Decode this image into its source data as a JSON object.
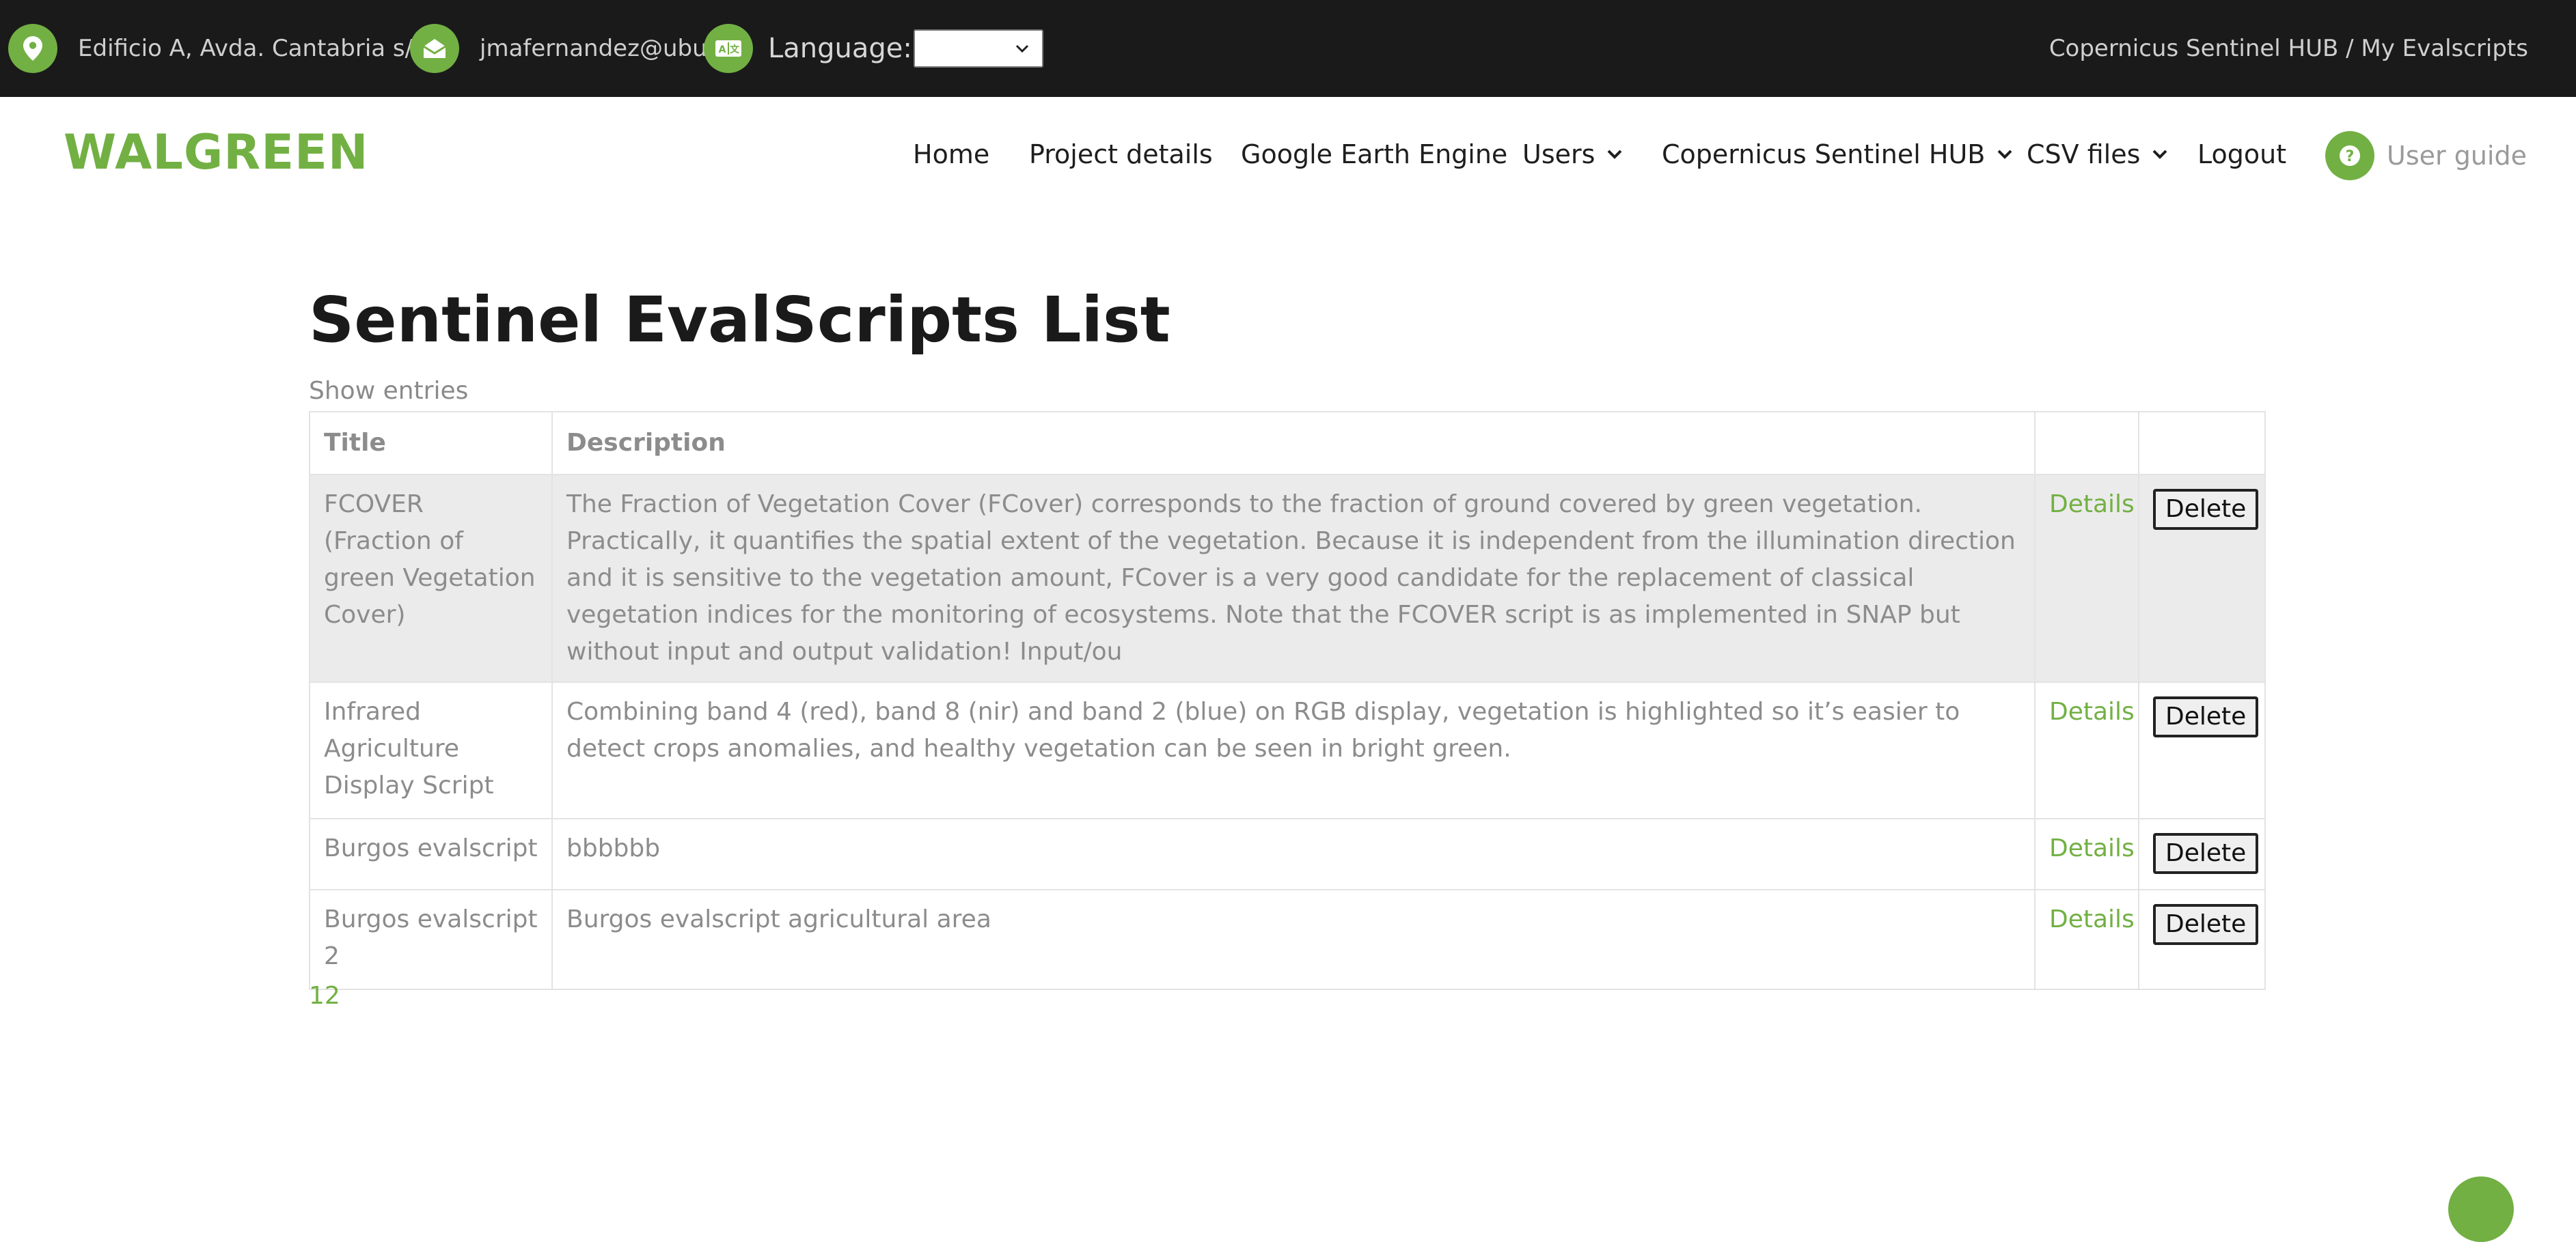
{
  "topbar": {
    "address": "Edificio A, Avda. Cantabria s/n",
    "email": "jmafernandez@ubu.es",
    "language_label": "Language:",
    "language_selected": "",
    "breadcrumb": "Copernicus Sentinel HUB / My Evalscripts"
  },
  "navbar": {
    "brand": "WALGREEN",
    "items": [
      {
        "label": "Home"
      },
      {
        "label": "Project details"
      },
      {
        "label": "Google Earth Engine"
      },
      {
        "label": "Users"
      },
      {
        "label": "Copernicus Sentinel HUB"
      },
      {
        "label": "CSV files"
      },
      {
        "label": "Logout"
      }
    ],
    "user_guide": "User guide"
  },
  "main": {
    "title": "Sentinel EvalScripts List",
    "show_entries": "Show entries",
    "table": {
      "headers": [
        "Title",
        "Description",
        "",
        ""
      ],
      "rows": [
        {
          "title": "FCOVER (Fraction of green Vegetation Cover)",
          "description": "The Fraction of Vegetation Cover (FCover) corresponds to the fraction of ground covered by green vegetation. Practically, it quantifies the spatial extent of the vegetation. Because it is independent from the illumination direction and it is sensitive to the vegetation amount, FCover is a very good candidate for the replacement of classical vegetation indices for the monitoring of ecosystems. Note that the FCOVER script is as implemented in SNAP but without input and output validation! Input/ou",
          "details": "Details",
          "delete": "Delete"
        },
        {
          "title": "Infrared Agriculture Display Script",
          "description": "Combining band 4 (red), band 8 (nir) and band 2 (blue) on RGB display, vegetation is highlighted so it’s easier to detect crops anomalies, and healthy vegetation can be seen in bright green.",
          "details": "Details",
          "delete": "Delete"
        },
        {
          "title": "Burgos evalscript",
          "description": "bbbbbb",
          "details": "Details",
          "delete": "Delete"
        },
        {
          "title": "Burgos evalscript 2",
          "description": "Burgos evalscript agricultural area",
          "details": "Details",
          "delete": "Delete"
        }
      ]
    },
    "pagination": "12"
  },
  "colors": {
    "accent": "#72b043",
    "topbar_bg": "#1a1a1a",
    "row_highlight": "#ebebeb"
  },
  "icons": {
    "address": "map-pin-icon",
    "email": "envelope-icon",
    "language": "translate-icon",
    "dropdown": "chevron-down-icon",
    "guide": "question-icon"
  }
}
